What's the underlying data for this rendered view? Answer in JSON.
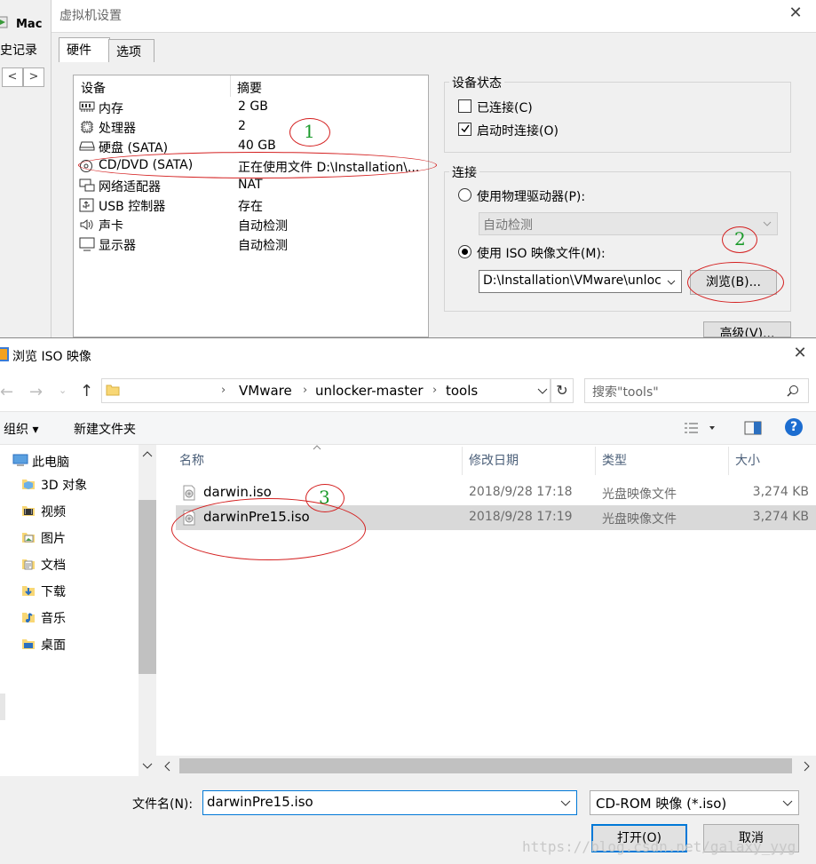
{
  "background_window": {
    "tab_label": "Mac",
    "history_label": "史记录",
    "nav_back": "<",
    "nav_forward": ">"
  },
  "vm_settings": {
    "title": "虚拟机设置",
    "close": "✕",
    "tabs": [
      "硬件",
      "选项"
    ],
    "table_headers": {
      "device": "设备",
      "summary": "摘要"
    },
    "devices": [
      {
        "name": "内存",
        "summary": "2 GB",
        "icon": "memory-icon"
      },
      {
        "name": "处理器",
        "summary": "2",
        "icon": "cpu-icon"
      },
      {
        "name": "硬盘 (SATA)",
        "summary": "40 GB",
        "icon": "harddisk-icon"
      },
      {
        "name": "CD/DVD (SATA)",
        "summary": "正在使用文件 D:\\Installation\\...",
        "icon": "cd-icon"
      },
      {
        "name": "网络适配器",
        "summary": "NAT",
        "icon": "network-icon"
      },
      {
        "name": "USB 控制器",
        "summary": "存在",
        "icon": "usb-icon"
      },
      {
        "name": "声卡",
        "summary": "自动检测",
        "icon": "speaker-icon"
      },
      {
        "name": "显示器",
        "summary": "自动检测",
        "icon": "monitor-icon"
      }
    ],
    "device_status": {
      "label": "设备状态",
      "connected": "已连接(C)",
      "connect_at_power_on": "启动时连接(O)"
    },
    "connection": {
      "label": "连接",
      "physical_drive": "使用物理驱动器(P):",
      "physical_drive_value": "自动检测",
      "iso_image": "使用 ISO 映像文件(M):",
      "iso_path": "D:\\Installation\\VMware\\unlocke",
      "browse": "浏览(B)..."
    },
    "advanced": "高级(V)..."
  },
  "file_dialog": {
    "title": "浏览 ISO 映像",
    "close": "✕",
    "breadcrumb": [
      "VMware",
      "unlocker-master",
      "tools"
    ],
    "search_placeholder": "搜索\"tools\"",
    "toolbar": {
      "organize": "组织 ▾",
      "new_folder": "新建文件夹"
    },
    "nav_items": [
      {
        "label": "此电脑",
        "icon": "computer-icon"
      },
      {
        "label": "3D 对象",
        "icon": "3d-objects-icon"
      },
      {
        "label": "视频",
        "icon": "video-icon"
      },
      {
        "label": "图片",
        "icon": "pictures-icon"
      },
      {
        "label": "文档",
        "icon": "documents-icon"
      },
      {
        "label": "下载",
        "icon": "downloads-icon"
      },
      {
        "label": "音乐",
        "icon": "music-icon"
      },
      {
        "label": "桌面",
        "icon": "desktop-icon"
      }
    ],
    "columns": {
      "name": "名称",
      "date": "修改日期",
      "type": "类型",
      "size": "大小"
    },
    "files": [
      {
        "name": "darwin.iso",
        "date": "2018/9/28 17:18",
        "type": "光盘映像文件",
        "size": "3,274 KB"
      },
      {
        "name": "darwinPre15.iso",
        "date": "2018/9/28 17:19",
        "type": "光盘映像文件",
        "size": "3,274 KB"
      }
    ],
    "filename_label": "文件名(N):",
    "filename_value": "darwinPre15.iso",
    "filetype_value": "CD-ROM 映像 (*.iso)",
    "open_button": "打开(O)",
    "cancel_button": "取消"
  },
  "annotations": [
    "1",
    "2",
    "3"
  ],
  "watermark": "https://blog.csdn.net/galaxy_yyg",
  "colors": {
    "annotation_red": "#d42020",
    "annotation_green": "#1a9a2a",
    "accent_blue": "#0078d7"
  }
}
